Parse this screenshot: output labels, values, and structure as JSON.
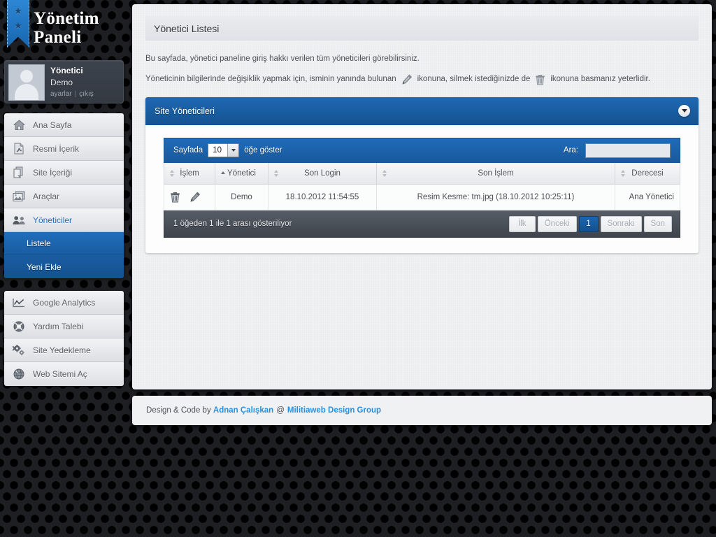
{
  "brand": {
    "title_line1": "Yönetim",
    "title_line2": "Paneli",
    "ribbon_star": "★"
  },
  "profile": {
    "role": "Yönetici",
    "name": "Demo",
    "settings_link": "ayarlar",
    "separator": "|",
    "logout_link": "çıkış"
  },
  "sidebar": {
    "primary_menu": [
      {
        "label": "Ana Sayfa",
        "icon": "home-icon",
        "active": false
      },
      {
        "label": "Resmi İçerik",
        "icon": "pdf-icon",
        "active": false
      },
      {
        "label": "Site İçeriği",
        "icon": "pages-icon",
        "active": false
      },
      {
        "label": "Araçlar",
        "icon": "media-icon",
        "active": false
      },
      {
        "label": "Yöneticiler",
        "icon": "users-icon",
        "active": true
      }
    ],
    "submenu": [
      {
        "label": "Listele",
        "selected": true
      },
      {
        "label": "Yeni Ekle",
        "selected": false
      }
    ],
    "secondary_menu": [
      {
        "label": "Google Analytics",
        "icon": "chart-icon"
      },
      {
        "label": "Yardım Talebi",
        "icon": "lifebuoy-icon"
      },
      {
        "label": "Site Yedekleme",
        "icon": "gears-icon"
      },
      {
        "label": "Web Sitemi Aç",
        "icon": "globe-icon"
      }
    ]
  },
  "page": {
    "title": "Yönetici Listesi",
    "desc_line1": "Bu sayfada, yönetici paneline giriş hakkı verilen tüm yöneticileri görebilirsiniz.",
    "desc_line2_a": "Yöneticinin bilgilerinde değişiklik yapmak için, isminin yanında bulunan",
    "desc_line2_b": "ikonuna, silmek istediğinizde de",
    "desc_line2_c": "ikonuna basmanız yeterlidir."
  },
  "panel": {
    "title": "Site Yöneticileri",
    "collapse_icon": "chevron-down-icon"
  },
  "datatable": {
    "length_label_prefix": "Sayfada",
    "length_value": "10",
    "length_label_suffix": "öğe göster",
    "search_label": "Ara:",
    "search_value": "",
    "search_placeholder": "",
    "columns": [
      {
        "label": "İşlem",
        "sort": "none"
      },
      {
        "label": "Yönetici",
        "sort": "asc"
      },
      {
        "label": "Son Login",
        "sort": "none"
      },
      {
        "label": "Son İşlem",
        "sort": "none"
      },
      {
        "label": "Derecesi",
        "sort": "none"
      }
    ],
    "rows": [
      {
        "delete_icon": "trash-icon",
        "edit_icon": "pencil-icon",
        "yonetici": "Demo",
        "son_login": "18.10.2012 11:54:55",
        "son_islem": "Resim Kesme: tm.jpg (18.10.2012 10:25:11)",
        "derecesi": "Ana Yönetici"
      }
    ],
    "info": "1 öğeden 1 ile 1 arası gösteriliyor",
    "pager": [
      {
        "label": "İlk",
        "current": false
      },
      {
        "label": "Önceki",
        "current": false
      },
      {
        "label": "1",
        "current": true
      },
      {
        "label": "Sonraki",
        "current": false
      },
      {
        "label": "Son",
        "current": false
      }
    ]
  },
  "footer": {
    "prefix": "Design & Code by",
    "author": "Adnan Çalışkan",
    "at": "@",
    "company": "Militiaweb Design Group"
  },
  "colors": {
    "accent_blue": "#1a5da2",
    "panel_header": "#14538f",
    "link_blue": "#2a8fdd",
    "dark_bg": "#1d1f23"
  }
}
